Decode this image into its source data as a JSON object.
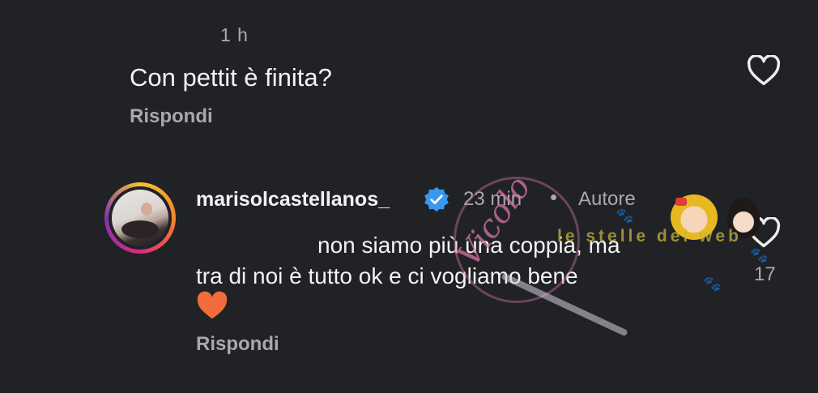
{
  "comment_parent": {
    "time": "1 h",
    "text": "Con pettit è finita?",
    "reply_label": "Rispondi",
    "like_icon": "heart-outline-icon"
  },
  "comment_reply": {
    "username": "marisolcastellanos_",
    "verified_icon": "verified-badge-icon",
    "time": "23 min",
    "separator": "•",
    "author_tag": "Autore",
    "text_line1": "non siamo più una coppia, ma",
    "text_line2": "tra di noi è tutto ok e ci vogliamo bene",
    "emoji": "orange-heart-emoji",
    "reply_label": "Rispondi",
    "like_icon": "heart-outline-icon",
    "like_count": "17"
  },
  "watermark": {
    "stamp_text": "Vicolo",
    "band_text": "le stelle del web"
  },
  "colors": {
    "background": "#202226",
    "text_primary": "#f3f3f3",
    "text_secondary": "#a8aaae",
    "verified_blue": "#3897f0",
    "heart_orange": "#f26b3a"
  }
}
